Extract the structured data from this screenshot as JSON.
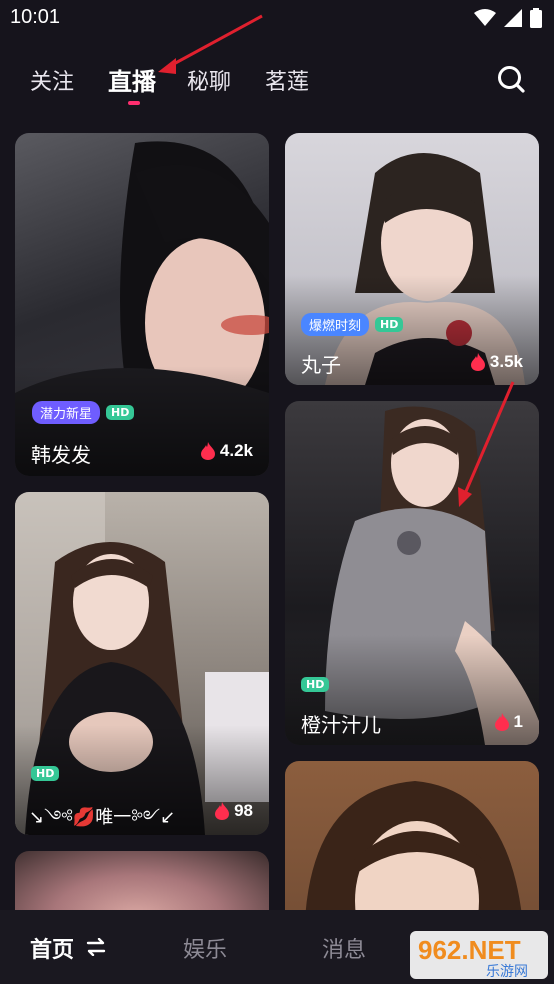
{
  "status_bar": {
    "time": "10:01"
  },
  "tabs": [
    {
      "label": "关注"
    },
    {
      "label": "直播"
    },
    {
      "label": "秘聊"
    },
    {
      "label": "茗莲"
    }
  ],
  "cards": [
    {
      "name": "韩发发",
      "tag": "潜力新星",
      "hd": "HD",
      "heat": "4.2k"
    },
    {
      "name": "丸子",
      "tag": "爆燃时刻",
      "hd": "HD",
      "heat": "3.5k"
    },
    {
      "name": "橙汁汁儿",
      "hd": "HD",
      "heat": "1"
    },
    {
      "name": "↘༺💋唯一༻↙",
      "hd": "HD",
      "heat": "98"
    }
  ],
  "bottom_nav": [
    {
      "label": "首页"
    },
    {
      "label": "娱乐"
    },
    {
      "label": "消息"
    }
  ],
  "watermark": {
    "brand": "962.NET",
    "sub": "乐游网"
  },
  "colors": {
    "accent": "#ff2e6f",
    "tag": "#6f5dff",
    "hd": "#35c796",
    "arrow": "#e0202e"
  }
}
